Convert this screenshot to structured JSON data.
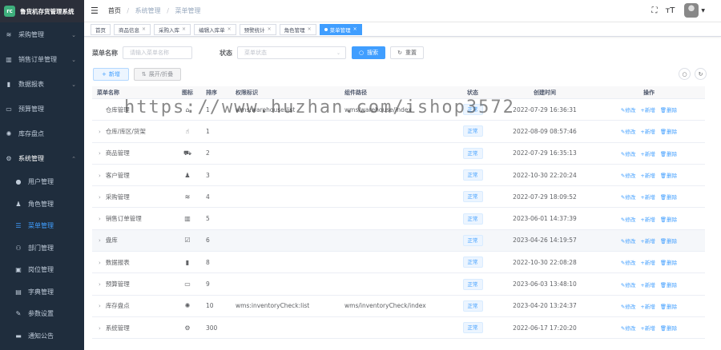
{
  "app": {
    "title": "鲁货机存货管理系统",
    "logo_text": "rc"
  },
  "sidebar": {
    "items": [
      {
        "label": "采购管理",
        "icon": "layers-icon",
        "glyph": "≋",
        "has_arrow": true
      },
      {
        "label": "销售订单管理",
        "icon": "book-icon",
        "glyph": "▥",
        "has_arrow": true
      },
      {
        "label": "数据报表",
        "icon": "chart-icon",
        "glyph": "▮",
        "has_arrow": true
      },
      {
        "label": "预算管理",
        "icon": "monitor-icon",
        "glyph": "▭",
        "has_arrow": false
      },
      {
        "label": "库存盘点",
        "icon": "cog-circle-icon",
        "glyph": "✺",
        "has_arrow": false
      },
      {
        "label": "系统管理",
        "icon": "gear-icon",
        "glyph": "⚙",
        "has_arrow": true
      }
    ],
    "sub_items": [
      {
        "label": "用户管理",
        "icon": "user-icon",
        "glyph": "●",
        "active": false
      },
      {
        "label": "角色管理",
        "icon": "role-icon",
        "glyph": "♟",
        "active": false
      },
      {
        "label": "菜单管理",
        "icon": "menu-list-icon",
        "glyph": "☰",
        "active": true
      },
      {
        "label": "部门管理",
        "icon": "tree-icon",
        "glyph": "⚇",
        "active": false
      },
      {
        "label": "岗位管理",
        "icon": "post-icon",
        "glyph": "▣",
        "active": false
      },
      {
        "label": "字典管理",
        "icon": "dict-icon",
        "glyph": "▤",
        "active": false
      },
      {
        "label": "参数设置",
        "icon": "edit-icon",
        "glyph": "✎",
        "active": false
      },
      {
        "label": "通知公告",
        "icon": "message-icon",
        "glyph": "▬",
        "active": false
      }
    ]
  },
  "navbar": {
    "breadcrumb": [
      "首页",
      "系统管理",
      "菜单管理"
    ],
    "separator": "/"
  },
  "tabs": [
    {
      "label": "首页",
      "closable": false,
      "active": false
    },
    {
      "label": "商品信息",
      "closable": true,
      "active": false
    },
    {
      "label": "采购入库",
      "closable": true,
      "active": false
    },
    {
      "label": "编辑入库单",
      "closable": true,
      "active": false
    },
    {
      "label": "预警统计",
      "closable": true,
      "active": false
    },
    {
      "label": "角色管理",
      "closable": true,
      "active": false
    },
    {
      "label": "菜单管理",
      "closable": true,
      "active": true
    }
  ],
  "search": {
    "name_label": "菜单名称",
    "name_placeholder": "请输入菜单名称",
    "status_label": "状态",
    "status_placeholder": "菜单状态",
    "search_button": "搜索",
    "reset_button": "重置"
  },
  "toolbar": {
    "add_button": "新增",
    "expand_button": "展开/折叠"
  },
  "table": {
    "columns": [
      "菜单名称",
      "图标",
      "排序",
      "权限标识",
      "组件路径",
      "状态",
      "创建时间",
      "操作"
    ],
    "ops": {
      "edit": "修改",
      "add": "新增",
      "delete": "删除"
    },
    "rows": [
      {
        "name": "仓库管理",
        "icon": "house-icon",
        "glyph": "⌂",
        "order": "1",
        "perm": "wms:warehouse:list",
        "component": "wms/warehouse/index",
        "status": "正常",
        "created": "2022-07-29 16:36:31",
        "expandable": false
      },
      {
        "name": "仓库/库区/货架",
        "icon": "thumb-icon",
        "glyph": "☝",
        "order": "1",
        "perm": "",
        "component": "",
        "status": "正常",
        "created": "2022-08-09 08:57:46",
        "expandable": true
      },
      {
        "name": "商品管理",
        "icon": "cart-icon",
        "glyph": "⛟",
        "order": "2",
        "perm": "",
        "component": "",
        "status": "正常",
        "created": "2022-07-29 16:35:13",
        "expandable": true
      },
      {
        "name": "客户管理",
        "icon": "peoples-icon",
        "glyph": "♟",
        "order": "3",
        "perm": "",
        "component": "",
        "status": "正常",
        "created": "2022-10-30 22:20:24",
        "expandable": true
      },
      {
        "name": "采购管理",
        "icon": "layers-icon",
        "glyph": "≋",
        "order": "4",
        "perm": "",
        "component": "",
        "status": "正常",
        "created": "2022-07-29 18:09:52",
        "expandable": true
      },
      {
        "name": "销售订单管理",
        "icon": "book-icon",
        "glyph": "▥",
        "order": "5",
        "perm": "",
        "component": "",
        "status": "正常",
        "created": "2023-06-01 14:37:39",
        "expandable": true
      },
      {
        "name": "盘库",
        "icon": "checkbox-icon",
        "glyph": "☑",
        "order": "6",
        "perm": "",
        "component": "",
        "status": "正常",
        "created": "2023-04-26 14:19:57",
        "expandable": true
      },
      {
        "name": "数据报表",
        "icon": "chart-icon",
        "glyph": "▮",
        "order": "8",
        "perm": "",
        "component": "",
        "status": "正常",
        "created": "2022-10-30 22:08:28",
        "expandable": true
      },
      {
        "name": "预算管理",
        "icon": "monitor-icon",
        "glyph": "▭",
        "order": "9",
        "perm": "",
        "component": "",
        "status": "正常",
        "created": "2023-06-03 13:48:10",
        "expandable": true
      },
      {
        "name": "库存盘点",
        "icon": "cog-circle-icon",
        "glyph": "✺",
        "order": "10",
        "perm": "wms:inventoryCheck:list",
        "component": "wms/inventoryCheck/index",
        "status": "正常",
        "created": "2023-04-20 13:24:37",
        "expandable": true
      },
      {
        "name": "系统管理",
        "icon": "gear-icon",
        "glyph": "⚙",
        "order": "300",
        "perm": "",
        "component": "",
        "status": "正常",
        "created": "2022-06-17 17:20:20",
        "expandable": true
      }
    ]
  },
  "watermark": "https://www.huzhan.com/ishop3572"
}
